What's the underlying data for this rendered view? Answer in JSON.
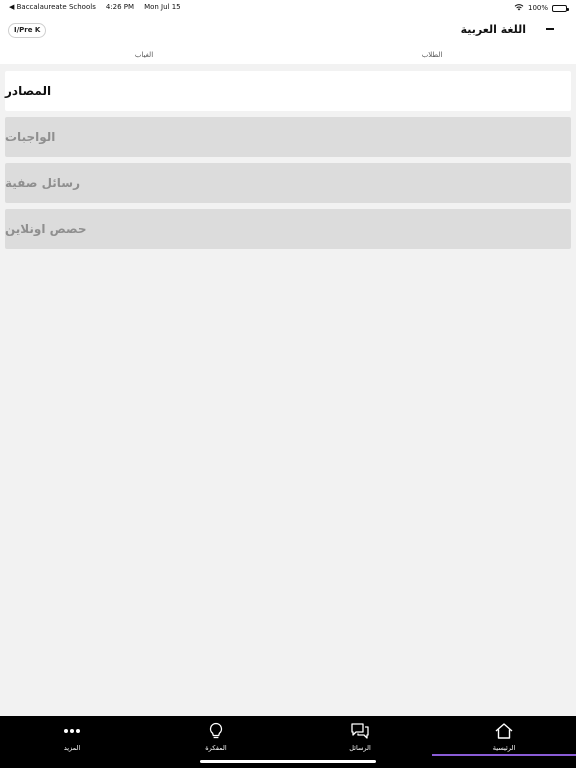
{
  "status_bar": {
    "back_app": "◀ Baccalaureate Schools",
    "time": "4:26 PM",
    "date": "Mon Jul 15",
    "battery": "100%"
  },
  "header": {
    "class_chip": "I/Pre K",
    "title": "اللغة العربية",
    "tabs": {
      "students": "الطلاب",
      "attendance": "الغياب"
    }
  },
  "sections": [
    {
      "label": "المصادر",
      "state": "active"
    },
    {
      "label": "الواجبات",
      "state": "disabled"
    },
    {
      "label": "رسائل صفية",
      "state": "disabled"
    },
    {
      "label": "حصص اونلاين",
      "state": "disabled"
    }
  ],
  "bottom_nav": {
    "more": "المزيد",
    "agenda": "المفكرة",
    "messages": "الرسائل",
    "home": "الرئيسية",
    "active": "home",
    "accent": "#8a5cd6"
  },
  "colors": {
    "background": "#f2f2f2",
    "card_active": "#ffffff",
    "card_disabled": "#dcdcdc",
    "tabbar": "#000000"
  }
}
